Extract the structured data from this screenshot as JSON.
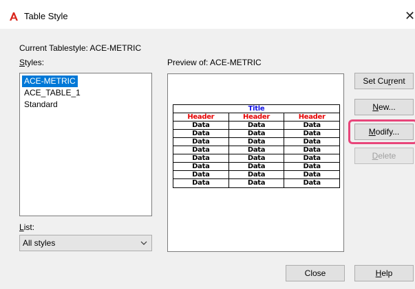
{
  "window": {
    "title": "Table Style",
    "close_glyph": "✕"
  },
  "labels": {
    "current_tablestyle": "Current Tablestyle: ACE-METRIC",
    "styles": "Styles:",
    "preview": "Preview of: ACE-METRIC",
    "list": "List:"
  },
  "styles_list": {
    "items": [
      "ACE-METRIC",
      "ACE_TABLE_1",
      "Standard"
    ],
    "selected": "ACE-METRIC"
  },
  "list_filter": {
    "value": "All styles"
  },
  "preview_table": {
    "title": "Title",
    "headers": [
      "Header",
      "Header",
      "Header"
    ],
    "cell": "Data",
    "title_color": "#1414e6",
    "header_color": "#e60000"
  },
  "buttons": {
    "set_current": "Set Current",
    "new": "New...",
    "modify": "Modify...",
    "delete": "Delete",
    "close": "Close",
    "help": "Help"
  },
  "colors": {
    "selection": "#0078d7",
    "highlight_ring": "#e8457a",
    "app_icon": "#d9261c"
  }
}
